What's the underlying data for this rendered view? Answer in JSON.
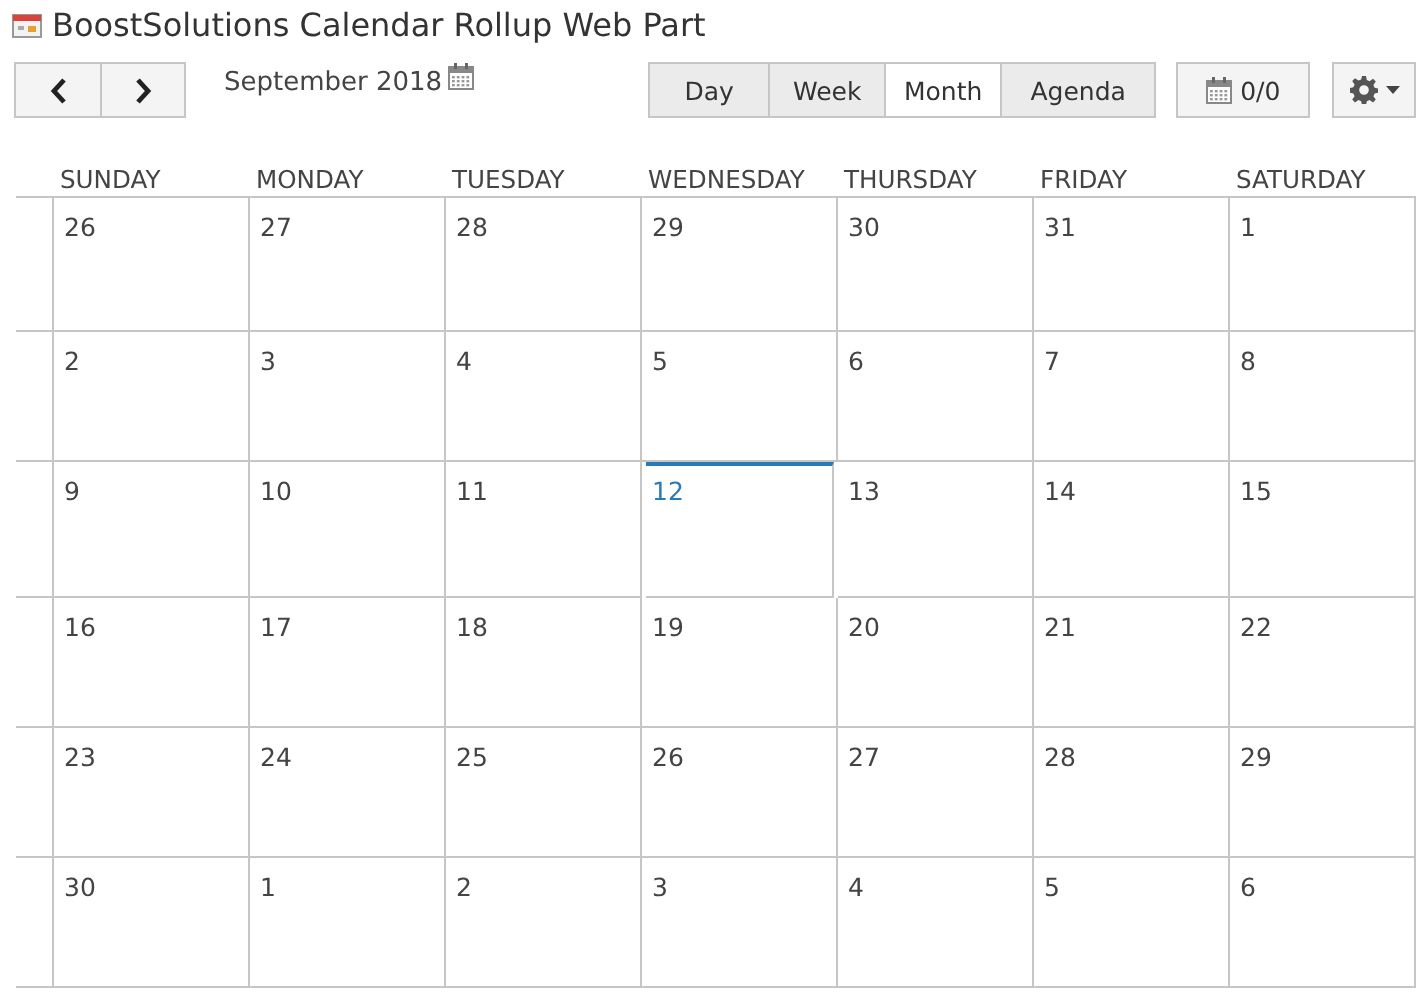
{
  "title": "BoostSolutions Calendar Rollup Web Part",
  "period": "September 2018",
  "views": [
    {
      "label": "Day",
      "selected": false
    },
    {
      "label": "Week",
      "selected": false
    },
    {
      "label": "Month",
      "selected": true
    },
    {
      "label": "Agenda",
      "selected": false
    }
  ],
  "item_count": "0/0",
  "weekdays": [
    "SUNDAY",
    "MONDAY",
    "TUESDAY",
    "WEDNESDAY",
    "THURSDAY",
    "FRIDAY",
    "SATURDAY"
  ],
  "weeks": [
    [
      {
        "day": "26",
        "today": false
      },
      {
        "day": "27",
        "today": false
      },
      {
        "day": "28",
        "today": false
      },
      {
        "day": "29",
        "today": false
      },
      {
        "day": "30",
        "today": false
      },
      {
        "day": "31",
        "today": false
      },
      {
        "day": "1",
        "today": false
      }
    ],
    [
      {
        "day": "2",
        "today": false
      },
      {
        "day": "3",
        "today": false
      },
      {
        "day": "4",
        "today": false
      },
      {
        "day": "5",
        "today": false
      },
      {
        "day": "6",
        "today": false
      },
      {
        "day": "7",
        "today": false
      },
      {
        "day": "8",
        "today": false
      }
    ],
    [
      {
        "day": "9",
        "today": false
      },
      {
        "day": "10",
        "today": false
      },
      {
        "day": "11",
        "today": false
      },
      {
        "day": "12",
        "today": true
      },
      {
        "day": "13",
        "today": false
      },
      {
        "day": "14",
        "today": false
      },
      {
        "day": "15",
        "today": false
      }
    ],
    [
      {
        "day": "16",
        "today": false
      },
      {
        "day": "17",
        "today": false
      },
      {
        "day": "18",
        "today": false
      },
      {
        "day": "19",
        "today": false
      },
      {
        "day": "20",
        "today": false
      },
      {
        "day": "21",
        "today": false
      },
      {
        "day": "22",
        "today": false
      }
    ],
    [
      {
        "day": "23",
        "today": false
      },
      {
        "day": "24",
        "today": false
      },
      {
        "day": "25",
        "today": false
      },
      {
        "day": "26",
        "today": false
      },
      {
        "day": "27",
        "today": false
      },
      {
        "day": "28",
        "today": false
      },
      {
        "day": "29",
        "today": false
      }
    ],
    [
      {
        "day": "30",
        "today": false
      },
      {
        "day": "1",
        "today": false
      },
      {
        "day": "2",
        "today": false
      },
      {
        "day": "3",
        "today": false
      },
      {
        "day": "4",
        "today": false
      },
      {
        "day": "5",
        "today": false
      },
      {
        "day": "6",
        "today": false
      }
    ]
  ]
}
